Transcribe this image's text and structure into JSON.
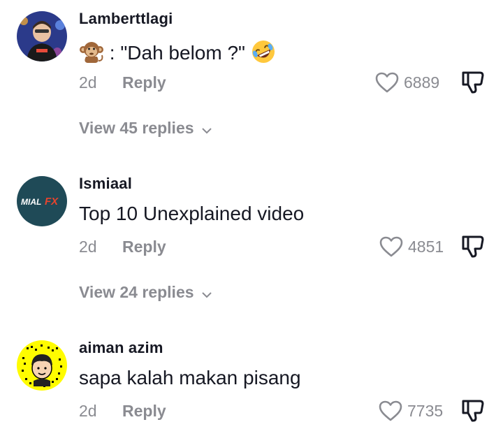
{
  "comments": [
    {
      "username": "Lamberttlagi",
      "text": ": \"Dah belom ?\"",
      "prefix_emoji": "monkey-emoji",
      "suffix_emoji": "rofl-emoji",
      "time": "2d",
      "reply_label": "Reply",
      "likes": "6889",
      "view_replies_prefix": "View",
      "view_replies_count": "45",
      "view_replies_suffix": "replies"
    },
    {
      "username": "Ismiaal",
      "avatar_logo_text_1": "MIAL",
      "avatar_logo_text_2": "FX",
      "text": "Top 10 Unexplained video",
      "time": "2d",
      "reply_label": "Reply",
      "likes": "4851",
      "view_replies_prefix": "View",
      "view_replies_count": "24",
      "view_replies_suffix": "replies"
    },
    {
      "username": "aiman azim",
      "text": "sapa kalah makan pisang",
      "time": "2d",
      "reply_label": "Reply",
      "likes": "7735"
    }
  ],
  "colors": {
    "text_primary": "#161823",
    "text_secondary": "#8a8b91",
    "icon": "#8a8b91"
  }
}
